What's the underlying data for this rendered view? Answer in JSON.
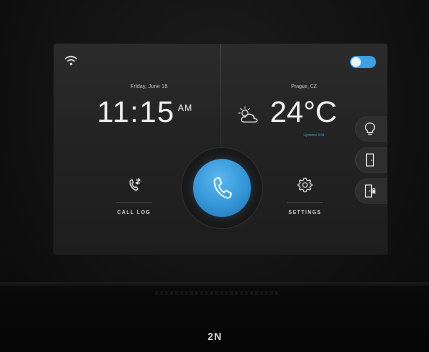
{
  "status_bar": {
    "wifi_icon": "wifi-icon",
    "toggle_state": "on",
    "toggle_color": "#3aa3e3"
  },
  "clock_panel": {
    "date": "Friday, June 18",
    "time": "11:15",
    "ampm": "AM"
  },
  "weather_panel": {
    "city": "Prague, CZ",
    "temperature": "24°C",
    "updated": "Updated 9:34",
    "icon": "partly-cloudy-icon"
  },
  "side_buttons": [
    {
      "icon": "lightbulb-icon"
    },
    {
      "icon": "door-icon"
    },
    {
      "icon": "door-lock-icon"
    }
  ],
  "main": {
    "call_button_icon": "phone-icon",
    "call_log_label": "CALL LOG",
    "settings_label": "SETTINGS"
  },
  "device": {
    "brand": "2N",
    "accent_color": "#3aa3e3"
  }
}
